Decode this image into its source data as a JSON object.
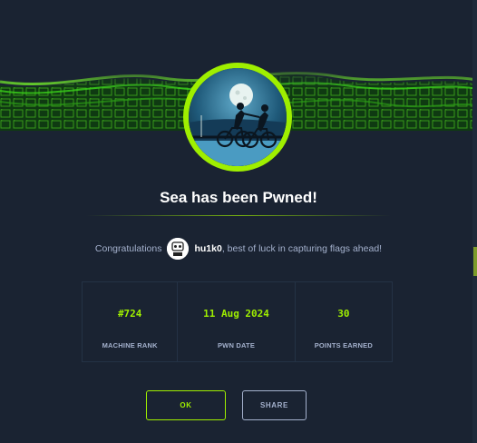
{
  "machine": {
    "title": "Sea has been Pwned!",
    "avatar_icon": "cyclists-moon-icon"
  },
  "message": {
    "prefix": "Congratulations",
    "username": "hu1k0",
    "suffix": ", best of luck in capturing flags ahead!",
    "avatar_icon": "user-avatar-icon"
  },
  "stats": [
    {
      "value": "#724",
      "label": "MACHINE RANK"
    },
    {
      "value": "11 Aug 2024",
      "label": "PWN DATE"
    },
    {
      "value": "30",
      "label": "POINTS EARNED"
    }
  ],
  "buttons": {
    "ok_label": "OK",
    "share_label": "SHARE"
  },
  "colors": {
    "accent": "#9fef00",
    "background": "#1a2332",
    "muted_text": "#a4b1cd",
    "border": "#243245"
  }
}
